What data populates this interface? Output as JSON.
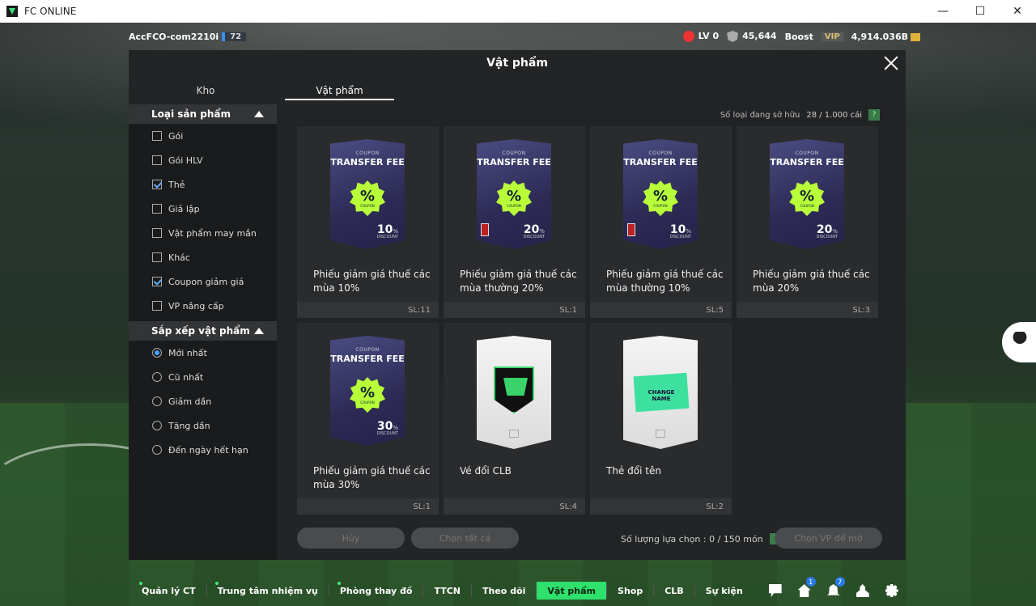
{
  "window": {
    "title": "FC ONLINE",
    "minimize": "—",
    "maximize": "☐",
    "close": "✕"
  },
  "topbar": {
    "account": "AccFCO-com2210i",
    "account_badge": "72",
    "level": "LV 0",
    "points": "45,644",
    "boost_label": "Boost",
    "vip_label": "VIP",
    "bp": "4,914.036B"
  },
  "modal": {
    "title": "Vật phẩm",
    "tabs": [
      {
        "label": "Kho"
      },
      {
        "label": "Vật phẩm"
      }
    ],
    "owned_label": "Số loại đang sở hữu",
    "owned_count": "28 / 1.000 cái",
    "help": "?",
    "filter_section": "Loại sản phẩm",
    "filters": [
      {
        "label": "Gói",
        "checked": false
      },
      {
        "label": "Gói HLV",
        "checked": false
      },
      {
        "label": "Thẻ",
        "checked": true
      },
      {
        "label": "Giả lập",
        "checked": false
      },
      {
        "label": "Vật phẩm may mắn",
        "checked": false
      },
      {
        "label": "Khác",
        "checked": false
      },
      {
        "label": "Coupon giảm giá",
        "checked": true
      },
      {
        "label": "VP nâng cấp",
        "checked": false
      }
    ],
    "sort_section": "Sắp xếp vật phẩm",
    "sorts": [
      {
        "label": "Mới nhất",
        "selected": true
      },
      {
        "label": "Cũ nhất",
        "selected": false
      },
      {
        "label": "Giảm dần",
        "selected": false
      },
      {
        "label": "Tăng dần",
        "selected": false
      },
      {
        "label": "Đến ngày hết hạn",
        "selected": false
      }
    ],
    "items": [
      {
        "name": "Phiếu giảm giá thuế các mùa 10%",
        "qty": "SL:11",
        "kind": "coupon",
        "coupon_small": "COUPON",
        "coupon_title": "TRANSFER FEE",
        "discount": "10",
        "pct_unit": "%",
        "disc_label": "DISCOUNT",
        "lock": false
      },
      {
        "name": "Phiếu giảm giá thuế các mùa thường 20%",
        "qty": "SL:1",
        "kind": "coupon",
        "coupon_small": "COUPON",
        "coupon_title": "TRANSFER FEE",
        "discount": "20",
        "pct_unit": "%",
        "disc_label": "DISCOUNT",
        "lock": true
      },
      {
        "name": "Phiếu giảm giá thuế các mùa thường 10%",
        "qty": "SL:5",
        "kind": "coupon",
        "coupon_small": "COUPON",
        "coupon_title": "TRANSFER FEE",
        "discount": "10",
        "pct_unit": "%",
        "disc_label": "DISCOUNT",
        "lock": true
      },
      {
        "name": "Phiếu giảm giá thuế các mùa 20%",
        "qty": "SL:3",
        "kind": "coupon",
        "coupon_small": "COUPON",
        "coupon_title": "TRANSFER FEE",
        "discount": "20",
        "pct_unit": "%",
        "disc_label": "DISCOUNT",
        "lock": false
      },
      {
        "name": "Phiếu giảm giá thuế các mùa 30%",
        "qty": "SL:1",
        "kind": "coupon",
        "coupon_small": "COUPON",
        "coupon_title": "TRANSFER FEE",
        "discount": "30",
        "pct_unit": "%",
        "disc_label": "DISCOUNT",
        "lock": false
      },
      {
        "name": "Vé đổi CLB",
        "qty": "SL:4",
        "kind": "club"
      },
      {
        "name": "Thẻ đổi tên",
        "qty": "SL:2",
        "kind": "rename",
        "ticket_text": "CHANGE NAME"
      }
    ],
    "badge_pct": "%",
    "badge_coupon": "COUPON",
    "cancel_label": "Hủy",
    "select_all_label": "Chọn tất cả",
    "selection_count": "Số lượng lựa chọn : 0 / 150 món",
    "open_label": "Chọn VP để mở"
  },
  "navbar": {
    "items": [
      {
        "label": "Quản lý CT",
        "dot": true
      },
      {
        "label": "Trung tâm nhiệm vụ",
        "dot": true
      },
      {
        "label": "Phòng thay đồ",
        "dot": true
      },
      {
        "label": "TTCN",
        "dot": false
      },
      {
        "label": "Theo dõi",
        "dot": false
      },
      {
        "label": "Vật phẩm",
        "dot": false,
        "active": true
      },
      {
        "label": "Shop",
        "dot": false
      },
      {
        "label": "CLB",
        "dot": false
      },
      {
        "label": "Sự kiện",
        "dot": false
      }
    ],
    "home_badge": "1",
    "bell_badge": "7"
  }
}
